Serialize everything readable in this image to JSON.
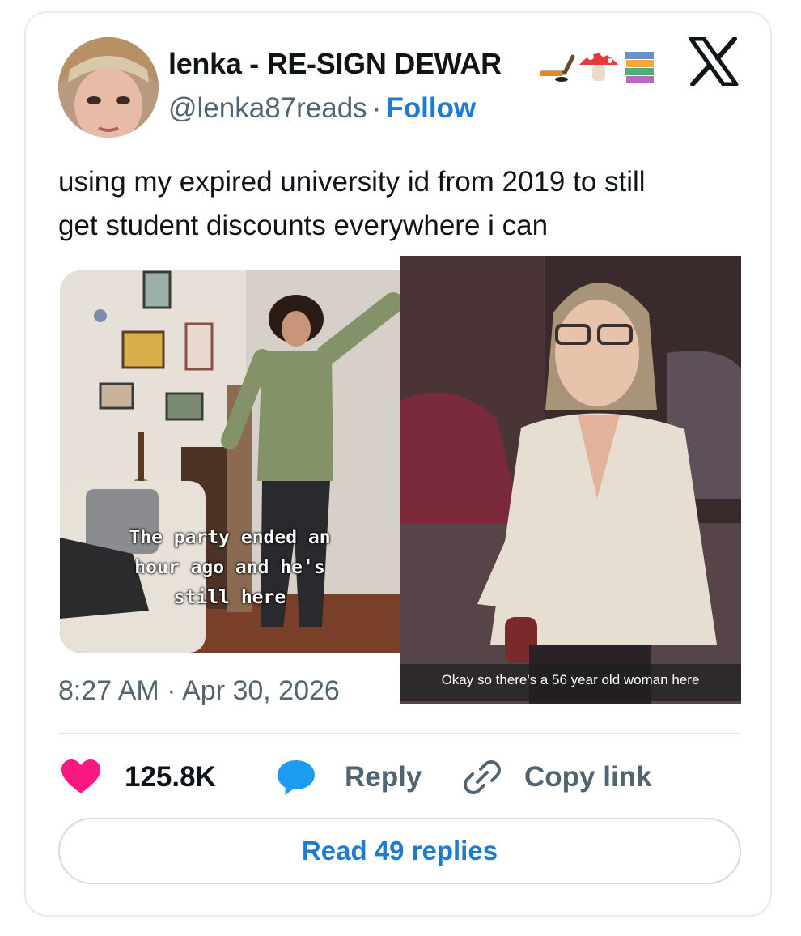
{
  "author": {
    "name": "lenka - RE-SIGN DEWAR",
    "name_emojis": [
      "hockey-stick-icon",
      "mushroom-icon",
      "books-icon"
    ],
    "handle": "@lenka87reads",
    "separator": "·",
    "follow_label": "Follow"
  },
  "brand_icon": "x-logo-icon",
  "tweet": {
    "text_line1": "using my expired university id from 2019 to still",
    "text_line2": "get student discounts everywhere i can"
  },
  "media": {
    "left": {
      "caption_line1": "The party ended an",
      "caption_line2": "hour ago and he's",
      "caption_line3": "still here"
    },
    "right": {
      "caption": "Okay so there's a 56 year old woman here"
    }
  },
  "timestamp": {
    "time": "8:27 AM",
    "separator": "·",
    "date": "Apr 30, 2026"
  },
  "actions": {
    "like_count": "125.8K",
    "reply_label": "Reply",
    "copy_link_label": "Copy link"
  },
  "read_replies_label": "Read 49 replies",
  "colors": {
    "follow": "#1d7bd0",
    "heart": "#f91880",
    "reply_bubble": "#1d9bf0",
    "secondary_text": "#536471",
    "primary_text": "#0f1419",
    "border": "#e7ebee"
  }
}
